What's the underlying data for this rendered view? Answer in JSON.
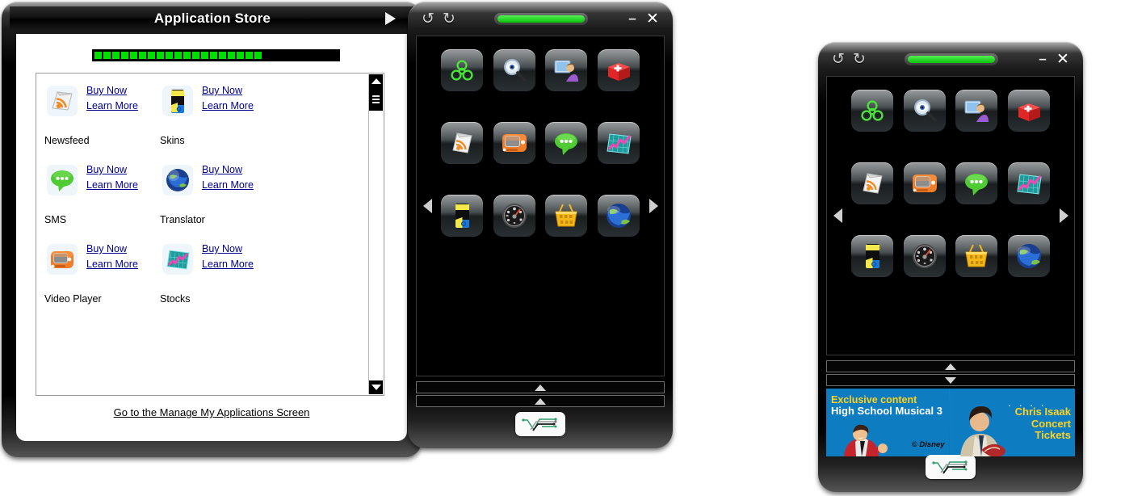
{
  "store_window": {
    "title": "Application Store",
    "title_arrow_icon": "play-right-icon",
    "progress": {
      "segments_filled": 19,
      "segments_total": 30,
      "color": "#00e000"
    },
    "apps": [
      {
        "name": "Newsfeed",
        "icon": "rss-newsfeed-icon",
        "buy": "Buy Now",
        "learn": "Learn More"
      },
      {
        "name": "Skins",
        "icon": "skins-phone-icon",
        "buy": "Buy Now",
        "learn": "Learn More"
      },
      {
        "name": "SMS",
        "icon": "chat-bubble-icon",
        "buy": "Buy Now",
        "learn": "Learn More"
      },
      {
        "name": "Translator",
        "icon": "globe-icon",
        "buy": "Buy Now",
        "learn": "Learn More"
      },
      {
        "name": "Video Player",
        "icon": "tv-icon",
        "buy": "Buy Now",
        "learn": "Learn More"
      },
      {
        "name": "Stocks",
        "icon": "stocks-chart-icon",
        "buy": "Buy Now",
        "learn": "Learn More"
      }
    ],
    "scrollbar": {
      "up_icon": "scroll-up-arrow-icon",
      "down_icon": "scroll-down-arrow-icon"
    },
    "manage_link": "Go to the Manage My Applications Screen"
  },
  "device_common": {
    "undo_icon": "undo-arrow-icon",
    "undo_glyph": "↺",
    "redo_icon": "redo-arrow-icon",
    "redo_glyph": "↻",
    "battery_icon": "battery-indicator",
    "battery_color": "#18d318",
    "minimize_label": "–",
    "close_label": "✕",
    "prev_page_icon": "arrow-left-icon",
    "next_page_icon": "arrow-right-icon",
    "logo_icon": "circuit-v-logo",
    "home_icons": [
      {
        "name": "biohazard-icon",
        "label": "Biohazard"
      },
      {
        "name": "spy-search-icon",
        "label": "Spy"
      },
      {
        "name": "remote-user-icon",
        "label": "Remote User"
      },
      {
        "name": "first-aid-icon",
        "label": "First Aid"
      },
      {
        "name": "rss-newsfeed-icon",
        "label": "Newsfeed"
      },
      {
        "name": "tv-icon",
        "label": "Video Player"
      },
      {
        "name": "chat-bubble-icon",
        "label": "SMS"
      },
      {
        "name": "stocks-chart-icon",
        "label": "Stocks"
      },
      {
        "name": "skins-phone-icon",
        "label": "Skins"
      },
      {
        "name": "dashboard-gauge-icon",
        "label": "Dashboard"
      },
      {
        "name": "basket-icon",
        "label": "Store"
      },
      {
        "name": "globe-icon",
        "label": "Translator"
      }
    ]
  },
  "device_window_1": {
    "panel_bar_1_icon": "expand-up-icon",
    "panel_bar_2_icon": "expand-up-icon",
    "ads_visible": false
  },
  "device_window_2": {
    "panel_bar_1_icon": "expand-up-icon",
    "panel_bar_2_icon": "collapse-down-icon",
    "ads_visible": true,
    "ads": [
      {
        "line1": "Exclusive content",
        "line2": "High School Musical 3",
        "credit": "© Disney"
      },
      {
        "line1": "Chris Isaak",
        "line2": "Concert",
        "line3": "Tickets"
      }
    ]
  }
}
